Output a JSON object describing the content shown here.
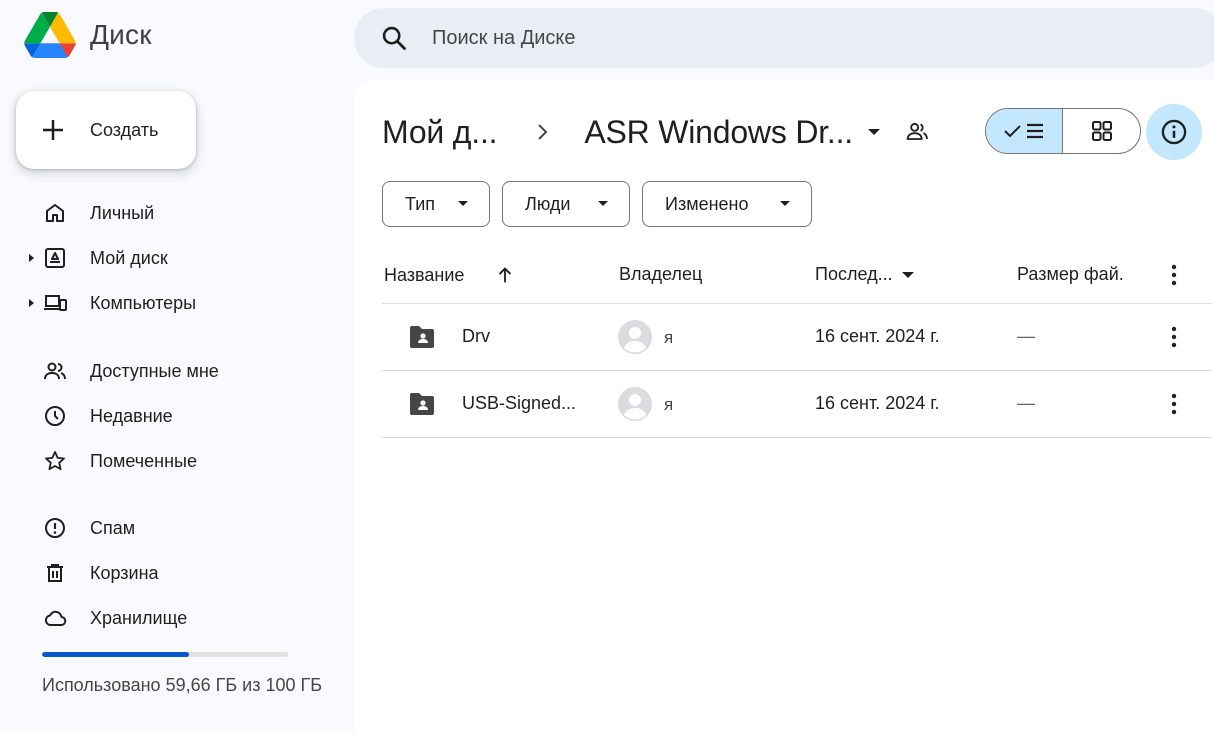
{
  "app": {
    "name": "Диск",
    "colors": {
      "accent": "#0b57d0",
      "selected": "#c2e7ff",
      "surface": "#f8fafd",
      "panel": "#ffffff"
    }
  },
  "sidebar": {
    "create_label": "Создать",
    "groups": [
      [
        {
          "label": "Личный",
          "icon": "home-icon"
        },
        {
          "label": "Мой диск",
          "icon": "my-drive-icon",
          "expandable": true
        },
        {
          "label": "Компьютеры",
          "icon": "computers-icon",
          "expandable": true
        }
      ],
      [
        {
          "label": "Доступные мне",
          "icon": "shared-with-me-icon"
        },
        {
          "label": "Недавние",
          "icon": "clock-icon"
        },
        {
          "label": "Помеченные",
          "icon": "star-icon"
        }
      ],
      [
        {
          "label": "Спам",
          "icon": "spam-icon"
        },
        {
          "label": "Корзина",
          "icon": "trash-icon"
        },
        {
          "label": "Хранилище",
          "icon": "cloud-icon"
        }
      ]
    ],
    "storage": {
      "used_fraction": 0.5966,
      "text": "Использовано 59,66 ГБ из 100 ГБ"
    }
  },
  "search": {
    "placeholder": "Поиск на Диске"
  },
  "breadcrumb": {
    "parent": "Мой д...",
    "current": "ASR Windows Dr..."
  },
  "filters": [
    {
      "label": "Тип"
    },
    {
      "label": "Люди"
    },
    {
      "label": "Изменено"
    }
  ],
  "table": {
    "columns": {
      "name": "Название",
      "owner": "Владелец",
      "modified": "Послед...",
      "size": "Размер фай."
    },
    "rows": [
      {
        "name": "Drv",
        "owner": "я",
        "modified": "16 сент. 2024 г.",
        "size": "—"
      },
      {
        "name": "USB-Signed...",
        "owner": "я",
        "modified": "16 сент. 2024 г.",
        "size": "—"
      }
    ]
  }
}
